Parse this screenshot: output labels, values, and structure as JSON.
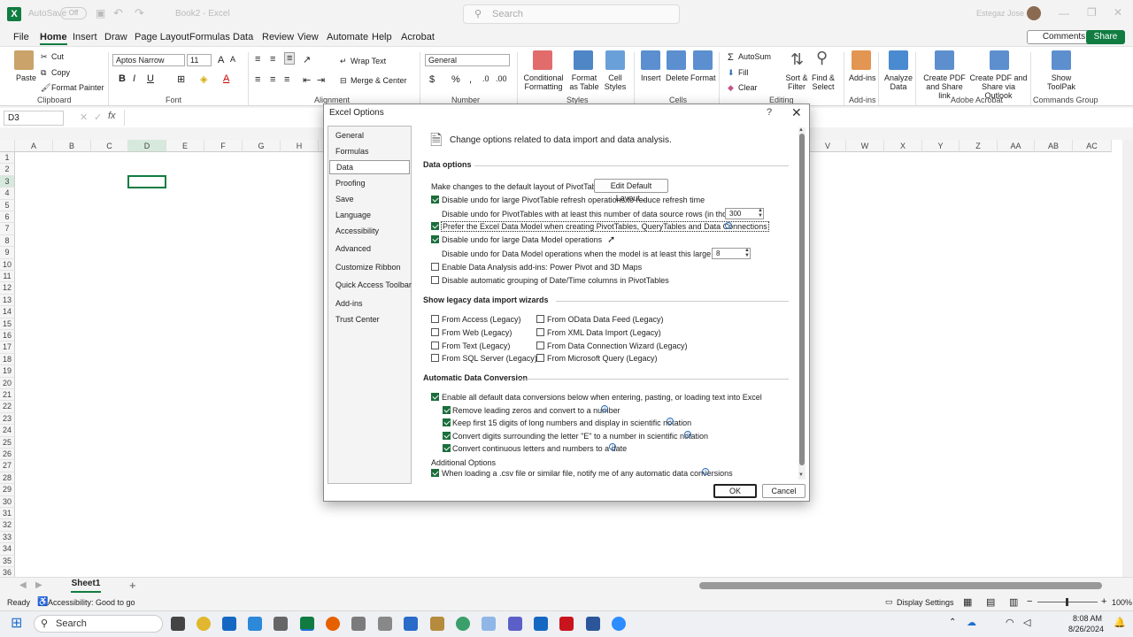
{
  "titlebar": {
    "autosave": "AutoSave",
    "autosave_state": "Off",
    "doc_title": "Book2 - Excel",
    "search_placeholder": "Search",
    "user": "Estegaz Jose"
  },
  "menu": [
    "File",
    "Home",
    "Insert",
    "Draw",
    "Page Layout",
    "Formulas",
    "Data",
    "Review",
    "View",
    "Automate",
    "Help",
    "Acrobat"
  ],
  "menu_active": "Home",
  "comments_label": "Comments",
  "share_label": "Share",
  "ribbon": {
    "paste": "Paste",
    "cut": "Cut",
    "copy": "Copy",
    "format_painter": "Format Painter",
    "group_clipboard": "Clipboard",
    "font_name": "Aptos Narrow",
    "font_size": "11",
    "group_font": "Font",
    "wrap_text": "Wrap Text",
    "merge_center": "Merge & Center",
    "group_alignment": "Alignment",
    "number_format": "General",
    "group_number": "Number",
    "conditional_formatting": "Conditional Formatting",
    "format_as_table": "Format as Table",
    "cell_styles": "Cell Styles",
    "group_styles": "Styles",
    "insert": "Insert",
    "delete": "Delete",
    "format": "Format",
    "group_cells": "Cells",
    "autosum": "AutoSum",
    "fill": "Fill",
    "clear": "Clear",
    "sort_filter": "Sort & Filter",
    "find_select": "Find & Select",
    "group_editing": "Editing",
    "addins": "Add-ins",
    "group_addins": "Add-ins",
    "analyze_data": "Analyze Data",
    "create_pdf_link": "Create PDF and Share link",
    "create_pdf_outlook": "Create PDF and Share via Outlook",
    "group_acrobat": "Adobe Acrobat",
    "show_toolpak": "Show ToolPak",
    "group_commands": "Commands Group"
  },
  "namebox": "D3",
  "fx": "fx",
  "columns_left": [
    "A",
    "B",
    "C",
    "D",
    "E",
    "F",
    "G",
    "H"
  ],
  "columns_right": [
    "V",
    "W",
    "X",
    "Y",
    "Z",
    "AA",
    "AB",
    "AC"
  ],
  "rows": [
    "1",
    "2",
    "3",
    "4",
    "5",
    "6",
    "7",
    "8",
    "9",
    "10",
    "11",
    "12",
    "13",
    "14",
    "15",
    "16",
    "17",
    "18",
    "19",
    "20",
    "21",
    "22",
    "23",
    "24",
    "25",
    "26",
    "27",
    "28",
    "29",
    "30",
    "31",
    "32",
    "33",
    "34",
    "35",
    "36"
  ],
  "sheet_tab": "Sheet1",
  "add_sheet": "+",
  "status": {
    "ready": "Ready",
    "accessibility": "Accessibility: Good to go",
    "display_settings": "Display Settings",
    "zoom": "100%"
  },
  "taskbar": {
    "search": "Search",
    "time": "8:08 AM",
    "date": "8/26/2024"
  },
  "dialog": {
    "title": "Excel Options",
    "help": "?",
    "close": "✕",
    "nav": [
      "General",
      "Formulas",
      "Data",
      "Proofing",
      "Save",
      "Language",
      "Accessibility",
      "Advanced",
      "Customize Ribbon",
      "Quick Access Toolbar",
      "Add-ins",
      "Trust Center"
    ],
    "nav_active": "Data",
    "header_text": "Change options related to data import and data analysis.",
    "sec_data_options": "Data options",
    "pivot_layout_label": "Make changes to the default layout of PivotTables:",
    "edit_default_layout": "Edit Default Layout...",
    "opt_disable_undo_pivot": "Disable undo for large PivotTable refresh operations to reduce refresh time",
    "opt_pivot_rows_label": "Disable undo for PivotTables with at least this number of data source rows (in thousands):",
    "opt_pivot_rows_value": "300",
    "opt_prefer_data_model": "Prefer the Excel Data Model when creating PivotTables, QueryTables and Data Connections",
    "opt_disable_undo_model": "Disable undo for large Data Model operations",
    "opt_model_size_label": "Disable undo for Data Model operations when the model is at least this large (in MB):",
    "opt_model_size_value": "8",
    "opt_enable_addins": "Enable Data Analysis add-ins: Power Pivot and 3D Maps",
    "opt_disable_grouping": "Disable automatic grouping of Date/Time columns in PivotTables",
    "sec_legacy": "Show legacy data import wizards",
    "legacy_left": [
      "From Access (Legacy)",
      "From Web (Legacy)",
      "From Text (Legacy)",
      "From SQL Server (Legacy)"
    ],
    "legacy_right": [
      "From OData Data Feed (Legacy)",
      "From XML Data Import (Legacy)",
      "From Data Connection Wizard (Legacy)",
      "From Microsoft Query (Legacy)"
    ],
    "sec_conversion": "Automatic Data Conversion",
    "opt_enable_all": "Enable all default data conversions below when entering, pasting, or loading text into Excel",
    "opt_remove_zeros": "Remove leading zeros and convert to a number",
    "opt_keep_15": "Keep first 15 digits of long numbers and display in scientific notation",
    "opt_convert_e": "Convert digits surrounding the letter \"E\" to a number in scientific notation",
    "opt_convert_date": "Convert continuous letters and numbers to a date",
    "additional_options": "Additional Options",
    "opt_csv_notify": "When loading a .csv file or similar file, notify me of any automatic data conversions",
    "ok": "OK",
    "cancel": "Cancel"
  }
}
